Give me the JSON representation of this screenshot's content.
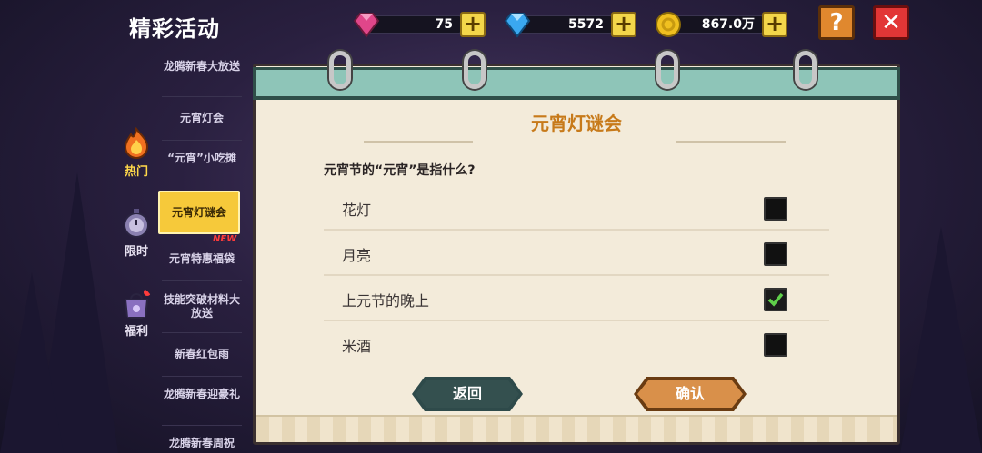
{
  "header": {
    "title": "精彩活动",
    "help_label": "?",
    "close_label": "✕"
  },
  "currencies": [
    {
      "icon": "pink-gem-icon",
      "value": "75",
      "color": "#e0468a"
    },
    {
      "icon": "blue-diamond-icon",
      "value": "5572",
      "color": "#3aa8f0"
    },
    {
      "icon": "gold-coin-icon",
      "value": "867.0万",
      "color": "#f0c020"
    }
  ],
  "categories": [
    {
      "label": "热门",
      "icon": "flame-icon",
      "active": true
    },
    {
      "label": "限时",
      "icon": "stopwatch-icon",
      "active": false
    },
    {
      "label": "福利",
      "icon": "gift-bag-icon",
      "active": false
    }
  ],
  "events": [
    {
      "label": "龙腾新春大放送"
    },
    {
      "label": "元宵灯会"
    },
    {
      "label": "“元宵”小吃摊"
    },
    {
      "label": "元宵灯谜会",
      "active": true,
      "badge": "NEW"
    },
    {
      "label": "元宵特惠福袋"
    },
    {
      "label": "技能突破材料大放送"
    },
    {
      "label": "新春红包雨"
    },
    {
      "label": "龙腾新春迎豪礼"
    },
    {
      "label": "龙腾新春周祝"
    }
  ],
  "panel": {
    "title": "元宵灯谜会",
    "question": "元宵节的“元宵”是指什么?",
    "options": [
      {
        "label": "花灯",
        "checked": false
      },
      {
        "label": "月亮",
        "checked": false
      },
      {
        "label": "上元节的晚上",
        "checked": true
      },
      {
        "label": "米酒",
        "checked": false
      }
    ],
    "back_label": "返回",
    "confirm_label": "确认"
  }
}
